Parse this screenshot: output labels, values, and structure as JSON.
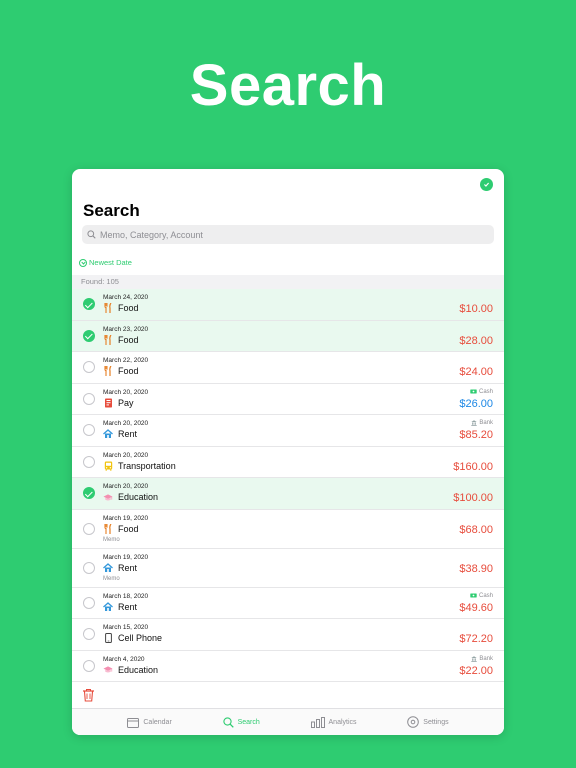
{
  "hero": {
    "title": "Search"
  },
  "header": {
    "title": "Search"
  },
  "search": {
    "placeholder": "Memo, Category, Account",
    "value": ""
  },
  "sort": {
    "label": "Newest Date"
  },
  "found": {
    "label": "Found: 105"
  },
  "colors": {
    "accent": "#2ecc71",
    "expense": "#e74c3c",
    "income": "#1e88e5"
  },
  "transactions": [
    {
      "date": "March 24, 2020",
      "category": "Food",
      "icon": "fork-knife-icon",
      "amount": "$10.00",
      "selected": true
    },
    {
      "date": "March 23, 2020",
      "category": "Food",
      "icon": "fork-knife-icon",
      "amount": "$28.00",
      "selected": true
    },
    {
      "date": "March 22, 2020",
      "category": "Food",
      "icon": "fork-knife-icon",
      "amount": "$24.00",
      "selected": false
    },
    {
      "date": "March 20, 2020",
      "category": "Pay",
      "icon": "pay-icon",
      "amount": "$26.00",
      "account": "Cash",
      "income": true,
      "selected": false
    },
    {
      "date": "March 20, 2020",
      "category": "Rent",
      "icon": "house-icon",
      "amount": "$85.20",
      "account": "Bank",
      "selected": false
    },
    {
      "date": "March 20, 2020",
      "category": "Transportation",
      "icon": "bus-icon",
      "amount": "$160.00",
      "selected": false
    },
    {
      "date": "March 20, 2020",
      "category": "Education",
      "icon": "graduation-cap-icon",
      "amount": "$100.00",
      "selected": true
    },
    {
      "date": "March 19, 2020",
      "category": "Food",
      "icon": "fork-knife-icon",
      "amount": "$68.00",
      "memo": "Memo",
      "selected": false
    },
    {
      "date": "March 19, 2020",
      "category": "Rent",
      "icon": "house-icon",
      "amount": "$38.90",
      "memo": "Memo",
      "selected": false
    },
    {
      "date": "March 18, 2020",
      "category": "Rent",
      "icon": "house-icon",
      "amount": "$49.60",
      "account": "Cash",
      "selected": false
    },
    {
      "date": "March 15, 2020",
      "category": "Cell Phone",
      "icon": "phone-icon",
      "amount": "$72.20",
      "selected": false
    },
    {
      "date": "March 4, 2020",
      "category": "Education",
      "icon": "graduation-cap-icon",
      "amount": "$22.00",
      "account": "Bank",
      "selected": false
    }
  ],
  "tabs": [
    {
      "label": "Calendar",
      "icon": "calendar-icon",
      "active": false
    },
    {
      "label": "Search",
      "icon": "search-icon",
      "active": true
    },
    {
      "label": "Analytics",
      "icon": "bar-chart-icon",
      "active": false
    },
    {
      "label": "Settings",
      "icon": "gear-icon",
      "active": false
    }
  ]
}
